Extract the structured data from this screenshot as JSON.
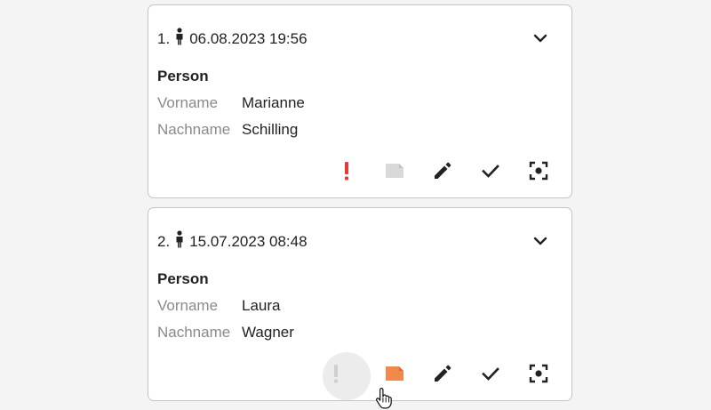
{
  "cards": [
    {
      "index": "1.",
      "datetime": "06.08.2023 19:56",
      "section_title": "Person",
      "fields": [
        {
          "label": "Vorname",
          "value": "Marianne"
        },
        {
          "label": "Nachname",
          "value": "Schilling"
        }
      ],
      "actions": {
        "alert_color": "#e53935",
        "note_color": "#d9d9d9",
        "note_active": false
      }
    },
    {
      "index": "2.",
      "datetime": "15.07.2023 08:48",
      "section_title": "Person",
      "fields": [
        {
          "label": "Vorname",
          "value": "Laura"
        },
        {
          "label": "Nachname",
          "value": "Wagner"
        }
      ],
      "actions": {
        "alert_color": "#cfcfcf",
        "note_color": "#f08a4b",
        "note_active": true
      }
    }
  ],
  "colors": {
    "icon_dark": "#222222",
    "label_gray": "#8a8a8a",
    "border": "#c4c4c4"
  },
  "icons": [
    "person-icon",
    "chevron-down-icon",
    "exclamation-icon",
    "note-icon",
    "pencil-icon",
    "check-icon",
    "focus-icon",
    "hand-cursor-icon"
  ]
}
